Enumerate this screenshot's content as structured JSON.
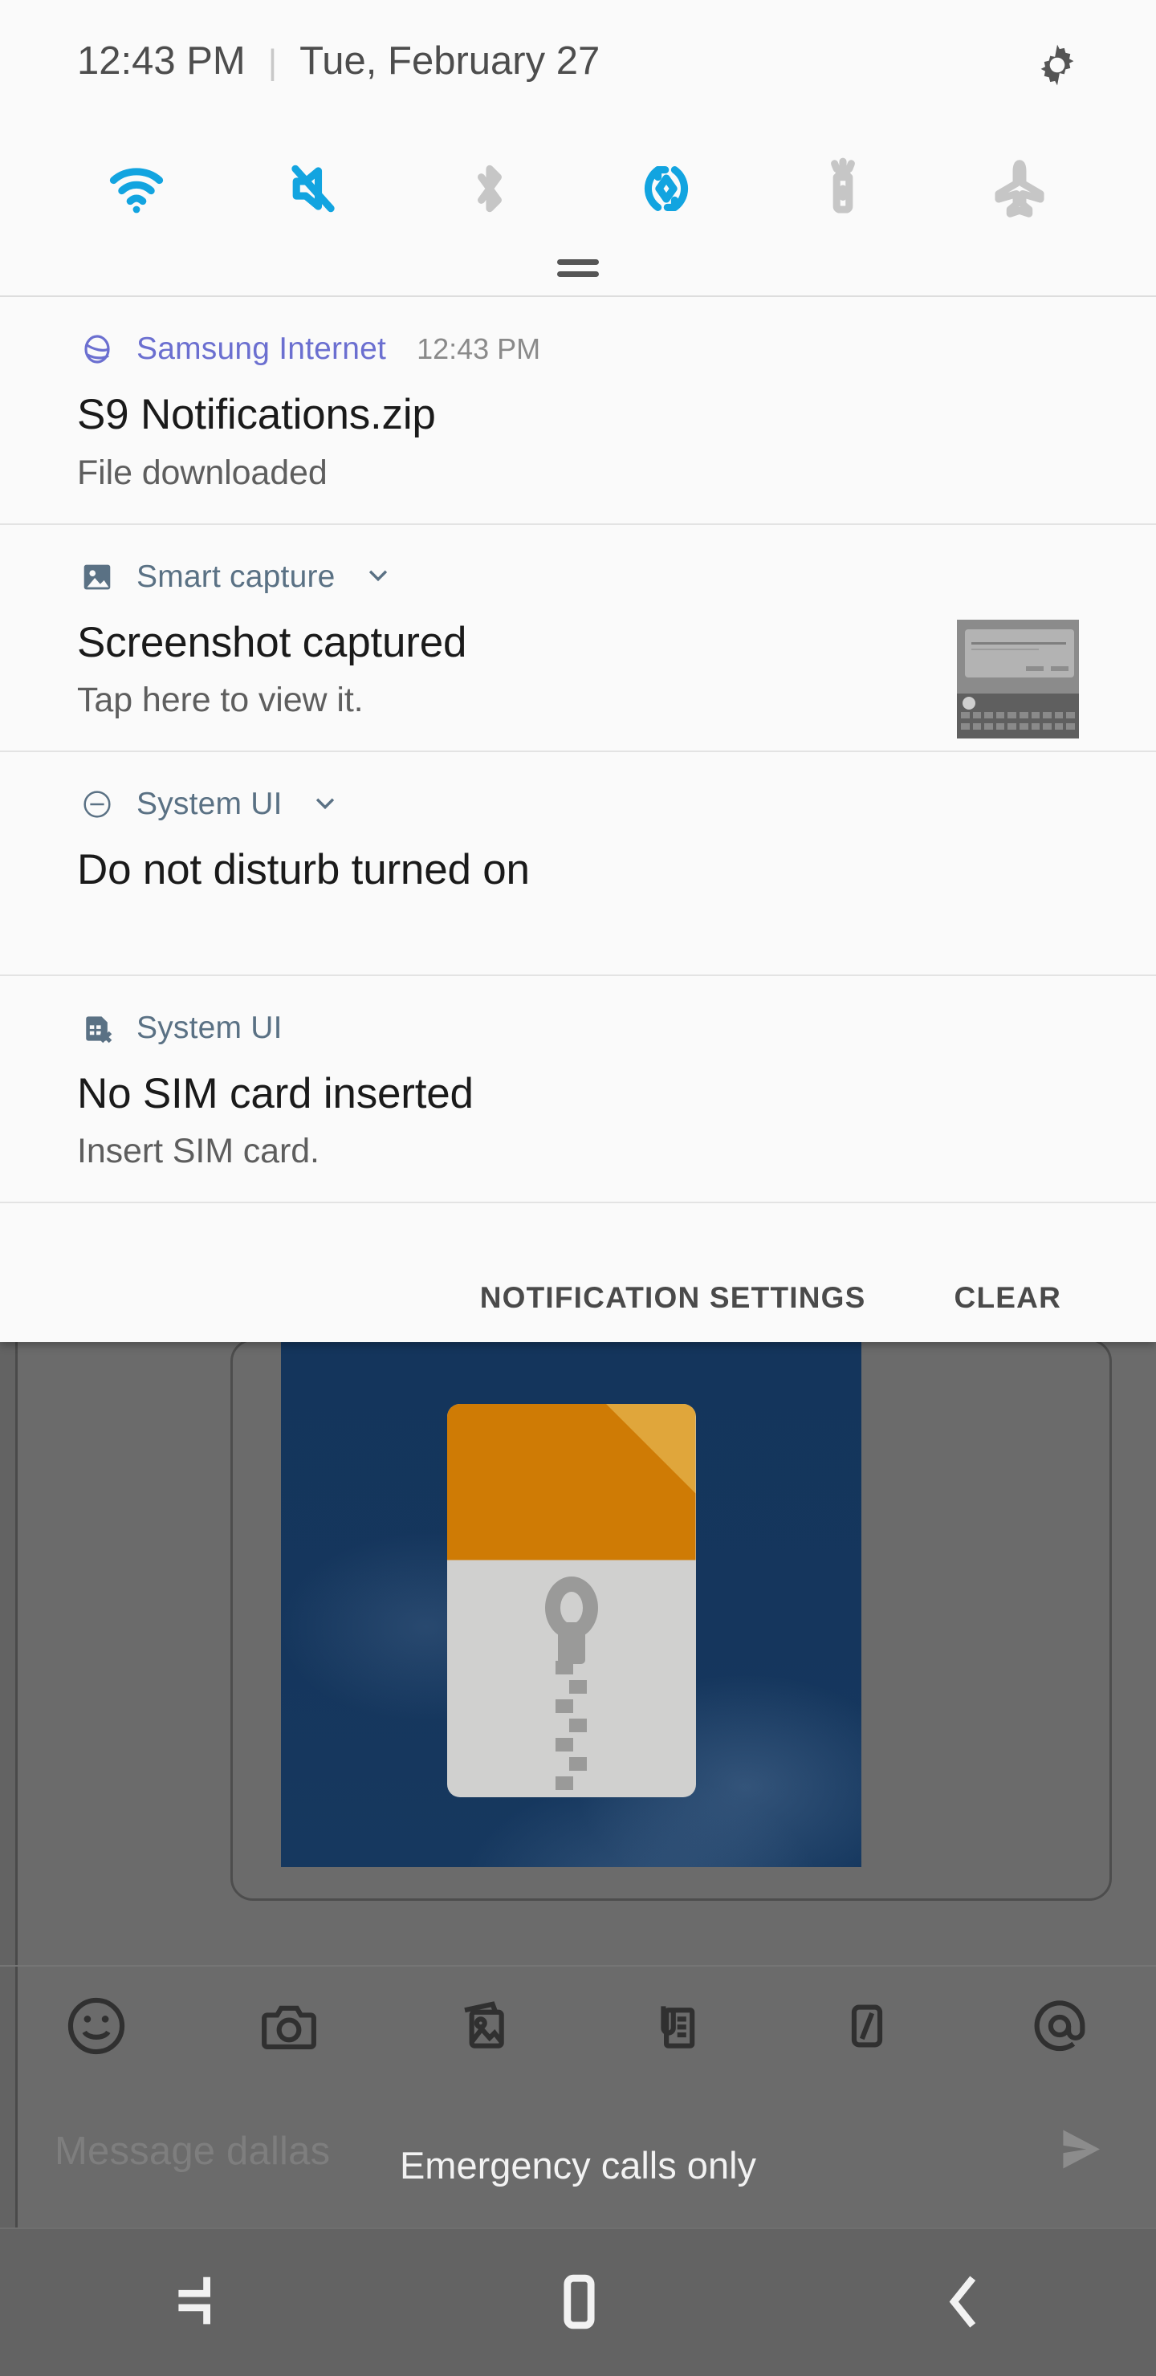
{
  "status_bar": {
    "time": "12:43 PM",
    "separator": "|",
    "date": "Tue, February 27",
    "settings_icon": "gear-icon"
  },
  "quick_settings": {
    "tiles": [
      {
        "name": "wifi",
        "icon": "wifi-icon",
        "label": "Wi-Fi",
        "active": true
      },
      {
        "name": "sound-off",
        "icon": "mute-icon",
        "label": "Mute",
        "active": true
      },
      {
        "name": "bluetooth",
        "icon": "bluetooth-icon",
        "label": "Bluetooth",
        "active": false
      },
      {
        "name": "auto-rotate",
        "icon": "auto-rotate-icon",
        "label": "Auto rotate",
        "active": true
      },
      {
        "name": "flashlight",
        "icon": "flashlight-icon",
        "label": "Flashlight",
        "active": false
      },
      {
        "name": "airplane",
        "icon": "airplane-icon",
        "label": "Airplane mode",
        "active": false
      }
    ],
    "handle": "drag-handle",
    "active_color": "#12a4e0",
    "inactive_color": "#c6c6c6"
  },
  "notifications": [
    {
      "app": "Samsung Internet",
      "app_icon": "samsung-internet-icon",
      "app_color": "#6b6fd0",
      "time": "12:43 PM",
      "title": "S9 Notifications.zip",
      "subtitle": "File downloaded",
      "expandable": false,
      "has_thumbnail": false
    },
    {
      "app": "Smart capture",
      "app_icon": "image-icon",
      "app_color": "#5a7184",
      "time": "",
      "title": "Screenshot captured",
      "subtitle": "Tap here to view it.",
      "expandable": true,
      "has_thumbnail": true
    },
    {
      "app": "System UI",
      "app_icon": "do-not-disturb-icon",
      "app_color": "#5a7184",
      "time": "",
      "title": "Do not disturb turned on",
      "subtitle": "",
      "expandable": true,
      "has_thumbnail": false
    },
    {
      "app": "System UI",
      "app_icon": "no-sim-card-icon",
      "app_color": "#5a7184",
      "time": "",
      "title": "No SIM card inserted",
      "subtitle": "Insert SIM card.",
      "expandable": false,
      "has_thumbnail": false
    }
  ],
  "shade_footer": {
    "notification_settings_label": "NOTIFICATION SETTINGS",
    "clear_label": "CLEAR"
  },
  "background_app": {
    "attachment": {
      "name": "zip-file-image",
      "description": "ZIP archive file icon"
    },
    "toolbar_icons": [
      {
        "name": "emoji-icon",
        "label": "Emoji"
      },
      {
        "name": "camera-icon",
        "label": "Camera"
      },
      {
        "name": "gallery-icon",
        "label": "Gallery"
      },
      {
        "name": "attachment-icon",
        "label": "Attach file"
      },
      {
        "name": "slash-icon",
        "label": "Quick text"
      },
      {
        "name": "mention-icon",
        "label": "Mention"
      }
    ],
    "message_input_placeholder": "Message dallas",
    "send_icon": "send-icon",
    "toast": "Emergency calls only"
  },
  "nav_bar": {
    "buttons": [
      {
        "name": "recents-button",
        "icon": "recents-icon",
        "label": "Recents"
      },
      {
        "name": "home-button",
        "icon": "home-icon",
        "label": "Home"
      },
      {
        "name": "back-button",
        "icon": "back-icon",
        "label": "Back"
      }
    ]
  }
}
